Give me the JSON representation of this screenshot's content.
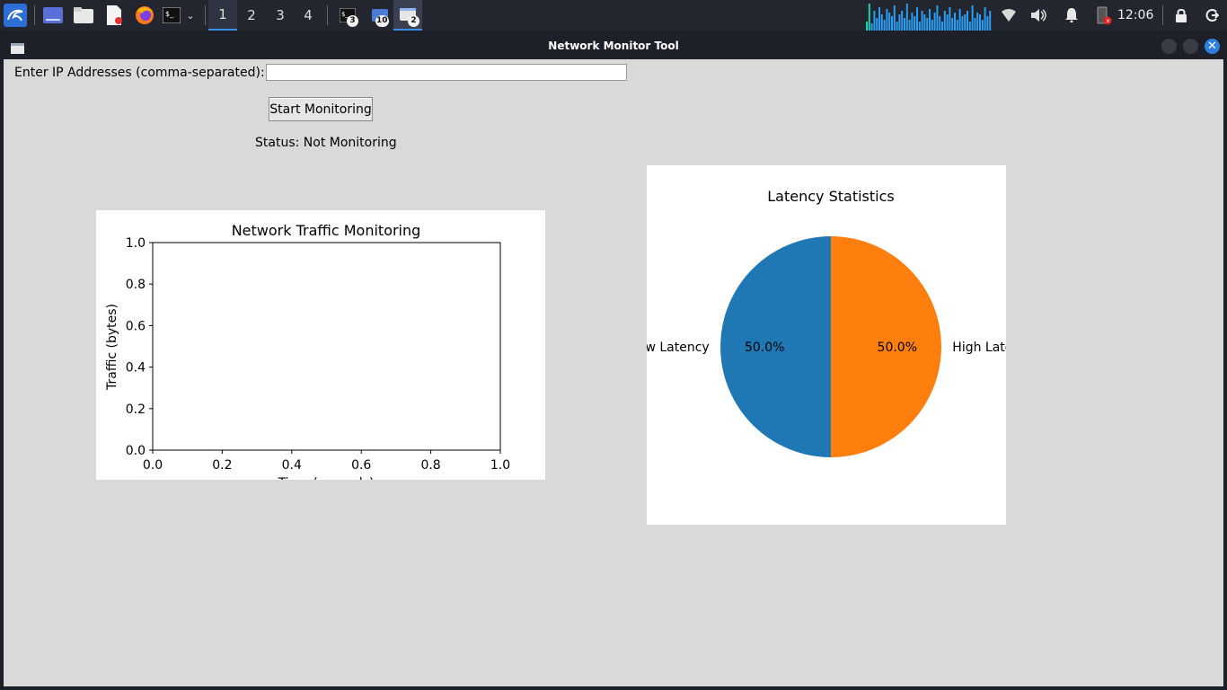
{
  "taskbar": {
    "workspaces": [
      "1",
      "2",
      "3",
      "4"
    ],
    "active_workspace": "1",
    "badges": {
      "terminal": "3",
      "files": "10",
      "windows": "2"
    },
    "clock": "12:06",
    "accent_color": "#3a8ee6"
  },
  "window": {
    "title": "Network Monitor Tool"
  },
  "form": {
    "ip_label": "Enter IP Addresses (comma-separated):",
    "ip_value": "",
    "start_button_label": "Start Monitoring",
    "status_text": "Status: Not Monitoring"
  },
  "chart_data": [
    {
      "type": "line",
      "title": "Network Traffic Monitoring",
      "xlabel": "Time (seconds)",
      "ylabel": "Traffic (bytes)",
      "xlim": [
        0.0,
        1.0
      ],
      "ylim": [
        0.0,
        1.0
      ],
      "x_ticks": [
        "0.0",
        "0.2",
        "0.4",
        "0.6",
        "0.8",
        "1.0"
      ],
      "y_ticks": [
        "0.0",
        "0.2",
        "0.4",
        "0.6",
        "0.8",
        "1.0"
      ],
      "series": [],
      "grid": false
    },
    {
      "type": "pie",
      "title": "Latency Statistics",
      "labels": [
        "Low Latency",
        "High Latency"
      ],
      "values": [
        50.0,
        50.0
      ],
      "percent_labels": [
        "50.0%",
        "50.0%"
      ],
      "colors": [
        "#1f77b4",
        "#ff7f0e"
      ]
    }
  ]
}
